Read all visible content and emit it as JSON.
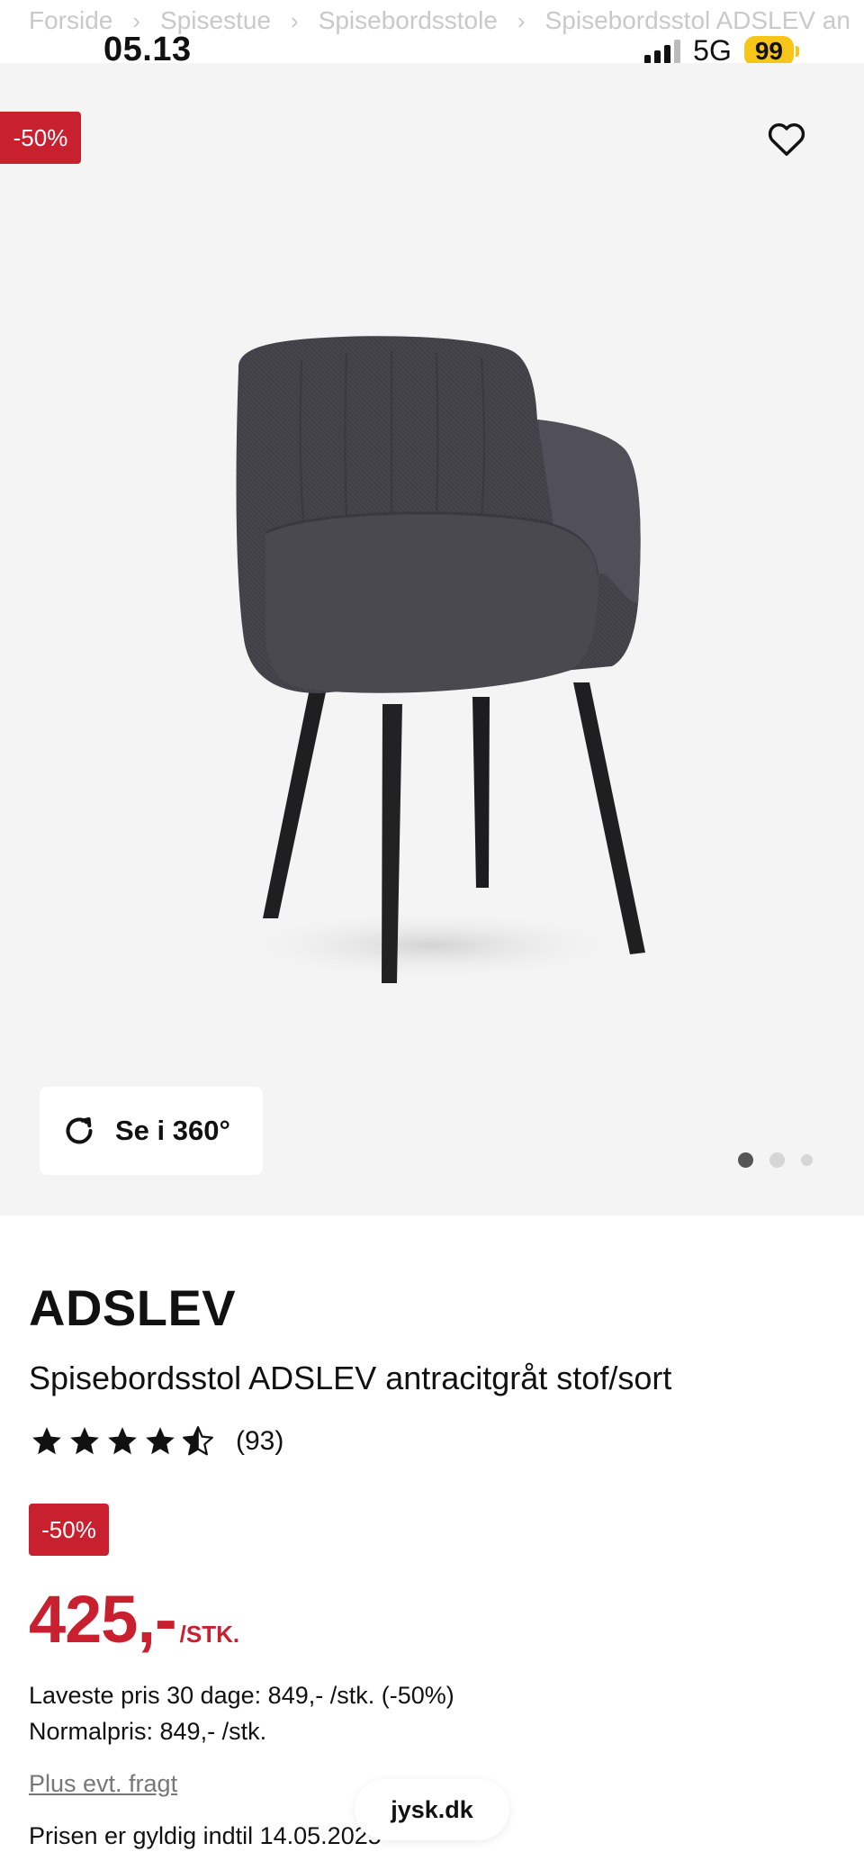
{
  "status_bar": {
    "time": "05.13",
    "network": "5G",
    "battery": "99"
  },
  "breadcrumb": {
    "items": [
      "Forside",
      "Spisestue",
      "Spisebordsstole",
      "Spisebordsstol ADSLEV an"
    ]
  },
  "gallery": {
    "discount_badge": "-50%",
    "view_360_label": "Se i 360°",
    "image_count": 3,
    "active_image": 1
  },
  "product": {
    "brand": "ADSLEV",
    "name": "Spisebordsstol ADSLEV antracitgråt stof/sort",
    "rating": 4.5,
    "review_count": "(93)",
    "discount_badge": "-50%",
    "price": "425,-",
    "unit": "/STK.",
    "lowest_price": "Laveste pris 30 dage: 849,- /stk. (-50%)",
    "normal_price": "Normalpris: 849,- /stk.",
    "shipping_link": "Plus evt. fragt",
    "valid_until": "Prisen er gyldig indtil 14.05.2025"
  },
  "browser": {
    "url": "jysk.dk"
  },
  "colors": {
    "sale_red": "#c8202f",
    "gallery_bg": "#f4f4f4",
    "battery_yellow": "#f6c518"
  }
}
